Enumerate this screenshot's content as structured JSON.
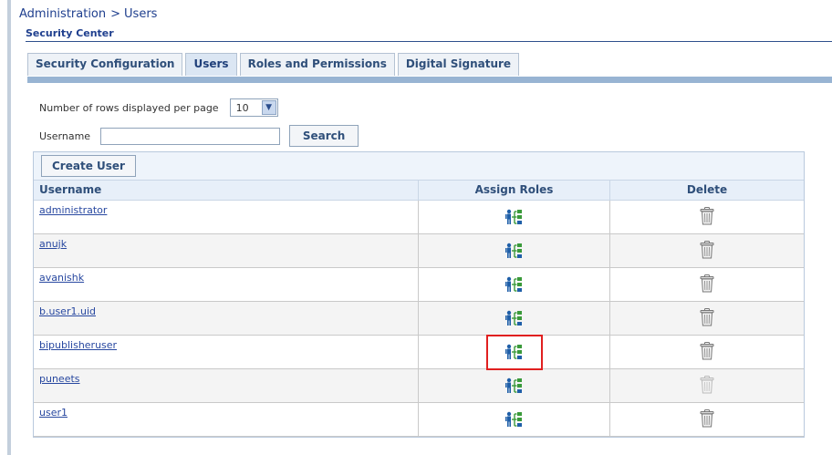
{
  "breadcrumb": {
    "parent": "Administration",
    "separator": ">",
    "current": "Users"
  },
  "section_title": "Security Center",
  "tabs": [
    {
      "label": "Security Configuration",
      "active": false
    },
    {
      "label": "Users",
      "active": true
    },
    {
      "label": "Roles and Permissions",
      "active": false
    },
    {
      "label": "Digital Signature",
      "active": false
    }
  ],
  "pagination": {
    "label": "Number of rows displayed per page",
    "selected": "10"
  },
  "search": {
    "label": "Username",
    "value": "",
    "button": "Search"
  },
  "toolbar": {
    "create_user": "Create User"
  },
  "table": {
    "headers": {
      "username": "Username",
      "assign_roles": "Assign Roles",
      "delete": "Delete"
    },
    "rows": [
      {
        "username": "administrator",
        "highlighted": false,
        "delete_enabled": true
      },
      {
        "username": "anujk",
        "highlighted": false,
        "delete_enabled": true
      },
      {
        "username": "avanishk",
        "highlighted": false,
        "delete_enabled": true
      },
      {
        "username": "b.user1.uid",
        "highlighted": false,
        "delete_enabled": true
      },
      {
        "username": "bipublisheruser",
        "highlighted": true,
        "delete_enabled": true
      },
      {
        "username": "puneets",
        "highlighted": false,
        "delete_enabled": false
      },
      {
        "username": "user1",
        "highlighted": false,
        "delete_enabled": true
      }
    ]
  },
  "colors": {
    "link": "#2848a0",
    "tab_bar": "#98b4d3",
    "highlight": "#e02020",
    "icon_blue": "#1f5fa8",
    "icon_green": "#3a9a3a"
  }
}
